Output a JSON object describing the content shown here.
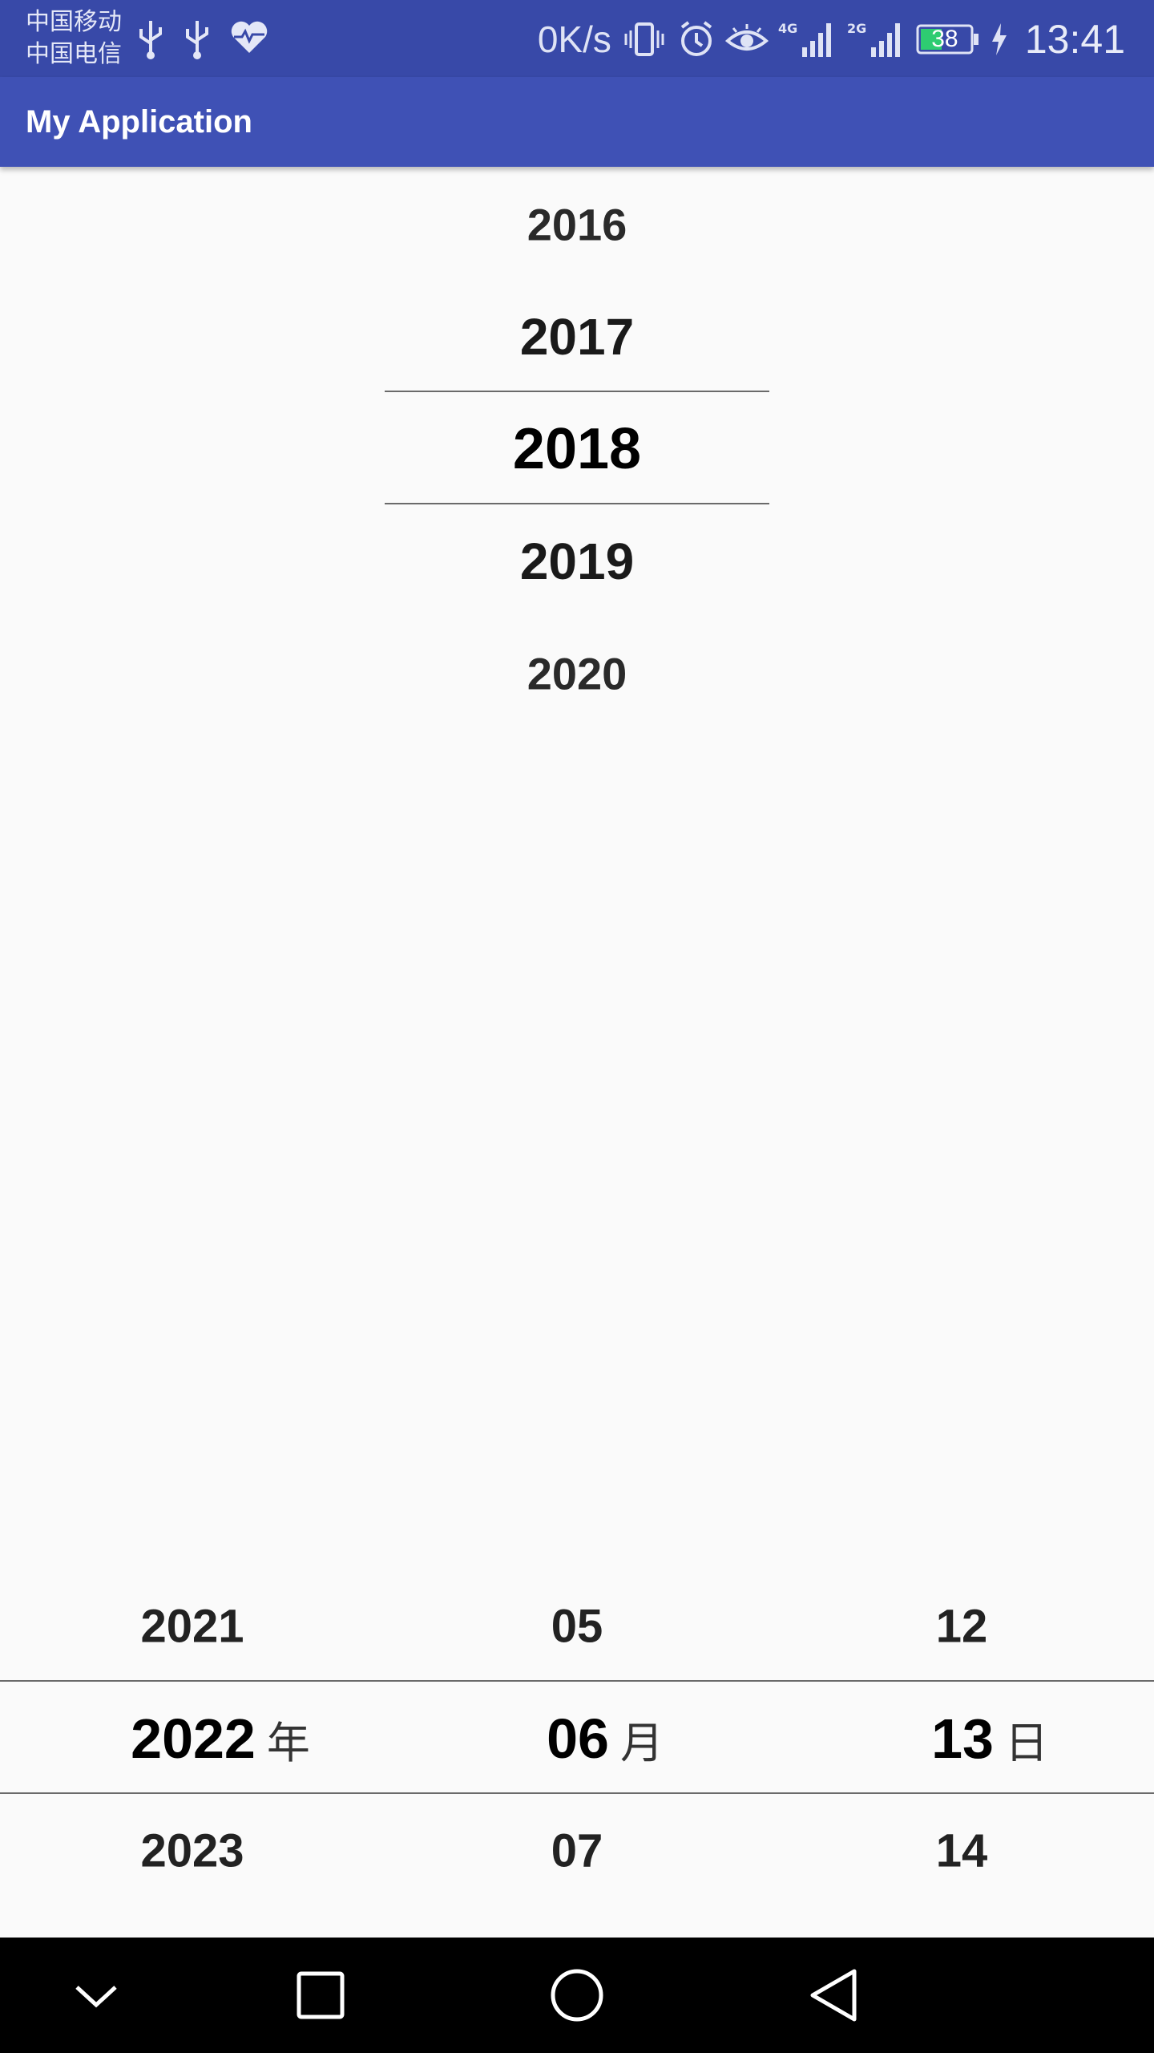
{
  "status_bar": {
    "carrier1": "中国移动",
    "carrier2": "中国电信",
    "net_speed": "0K/s",
    "battery": "38",
    "time": "13:41",
    "icons": [
      "usb-icon",
      "usb-icon",
      "heart-pulse-icon",
      "vibrate-icon",
      "alarm-icon",
      "eye-icon",
      "signal-4g-icon",
      "signal-2g-icon",
      "battery-icon",
      "charging-icon"
    ]
  },
  "app_bar": {
    "title": "My Application"
  },
  "year_wheel": {
    "items": [
      "2016",
      "2017",
      "2018",
      "2019",
      "2020"
    ],
    "selected_index": 2
  },
  "date_picker": {
    "year": {
      "items": [
        "2021",
        "2022",
        "2023"
      ],
      "unit": "年"
    },
    "month": {
      "items": [
        "05",
        "06",
        "07"
      ],
      "unit": "月"
    },
    "day": {
      "items": [
        "12",
        "13",
        "14"
      ],
      "unit": "日"
    },
    "selected_index": 1
  },
  "nav_bar": {
    "icons": [
      "chevron-down-icon",
      "recents-square-icon",
      "home-circle-icon",
      "back-triangle-icon"
    ]
  },
  "colors": {
    "status_bar": "#3849a8",
    "app_bar": "#3f51b5",
    "background": "#fafafa",
    "nav_bar": "#000000",
    "battery_fill": "#2ecc71"
  }
}
